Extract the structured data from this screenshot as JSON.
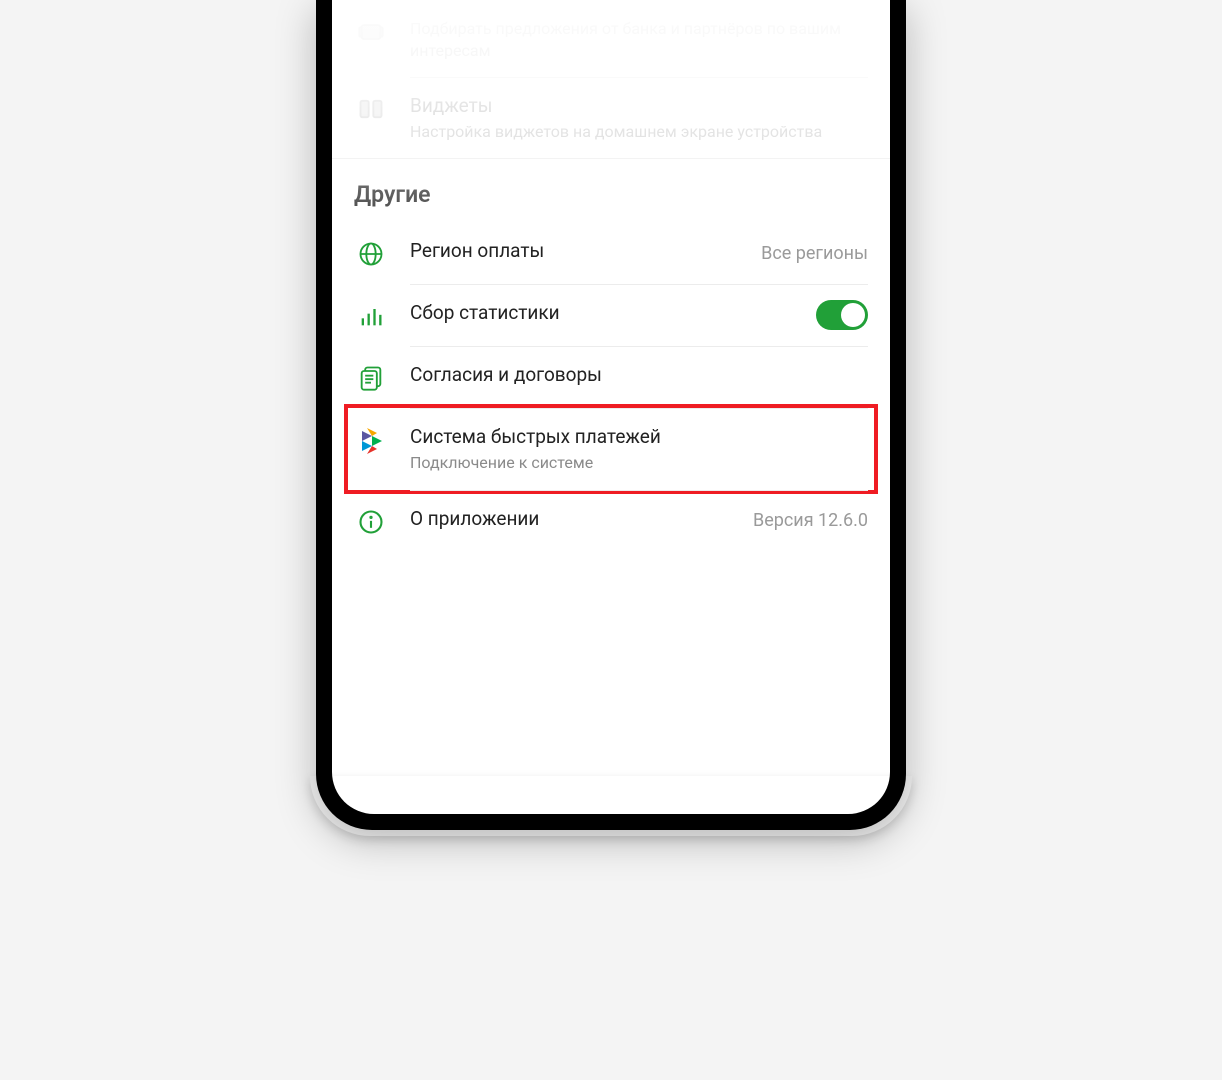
{
  "top_items": [
    {
      "icon": "offers-icon",
      "title": "",
      "subtitle": "Подбирать предложения от банка и партнёров по вашим интересам"
    },
    {
      "icon": "widgets-icon",
      "title": "Виджеты",
      "subtitle": "Настройка виджетов на домашнем экране устройства"
    }
  ],
  "section_header": "Другие",
  "items": [
    {
      "icon": "globe-icon",
      "title": "Регион оплаты",
      "trailing": "Все регионы"
    },
    {
      "icon": "stats-icon",
      "title": "Сбор статистики",
      "toggle": true
    },
    {
      "icon": "documents-icon",
      "title": "Согласия и договоры"
    },
    {
      "icon": "sbp-icon",
      "title": "Система быстрых платежей",
      "subtitle": "Подключение к системе",
      "highlighted": true
    },
    {
      "icon": "info-icon",
      "title": "О приложении",
      "trailing": "Версия 12.6.0"
    }
  ],
  "colors": {
    "accent": "#21a038",
    "highlight": "#ef1c23"
  }
}
